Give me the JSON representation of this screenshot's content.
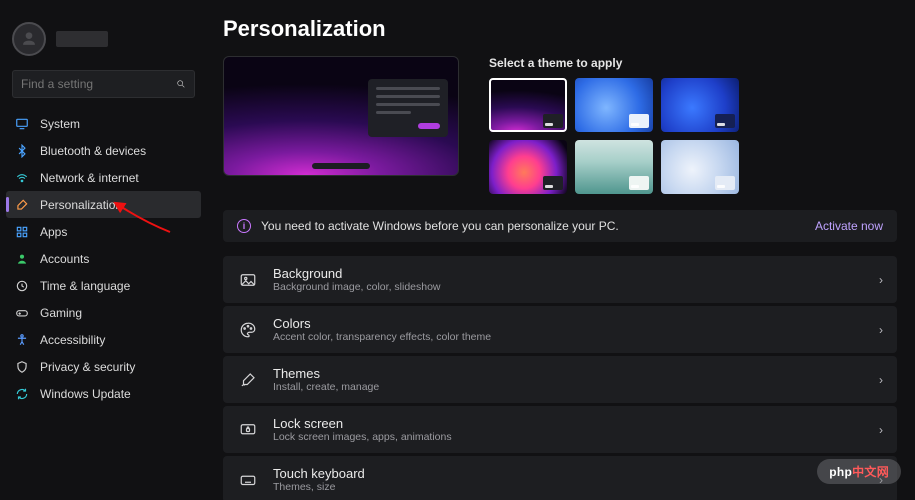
{
  "sidebar": {
    "search_placeholder": "Find a setting",
    "items": [
      {
        "id": "system",
        "label": "System"
      },
      {
        "id": "bluetooth",
        "label": "Bluetooth & devices"
      },
      {
        "id": "network",
        "label": "Network & internet"
      },
      {
        "id": "personal",
        "label": "Personalization"
      },
      {
        "id": "apps",
        "label": "Apps"
      },
      {
        "id": "accounts",
        "label": "Accounts"
      },
      {
        "id": "time",
        "label": "Time & language"
      },
      {
        "id": "gaming",
        "label": "Gaming"
      },
      {
        "id": "access",
        "label": "Accessibility"
      },
      {
        "id": "privacy",
        "label": "Privacy & security"
      },
      {
        "id": "update",
        "label": "Windows Update"
      }
    ],
    "active_index": 3
  },
  "page": {
    "title": "Personalization",
    "theme_label": "Select a theme to apply",
    "selected_theme_index": 0
  },
  "banner": {
    "text": "You need to activate Windows before you can personalize your PC.",
    "action": "Activate now"
  },
  "rows": [
    {
      "id": "background",
      "title": "Background",
      "desc": "Background image, color, slideshow"
    },
    {
      "id": "colors",
      "title": "Colors",
      "desc": "Accent color, transparency effects, color theme"
    },
    {
      "id": "themes",
      "title": "Themes",
      "desc": "Install, create, manage"
    },
    {
      "id": "lock",
      "title": "Lock screen",
      "desc": "Lock screen images, apps, animations"
    },
    {
      "id": "keyboard",
      "title": "Touch keyboard",
      "desc": "Themes, size"
    }
  ],
  "watermark": {
    "brand": "php",
    "suffix": "中文网"
  }
}
